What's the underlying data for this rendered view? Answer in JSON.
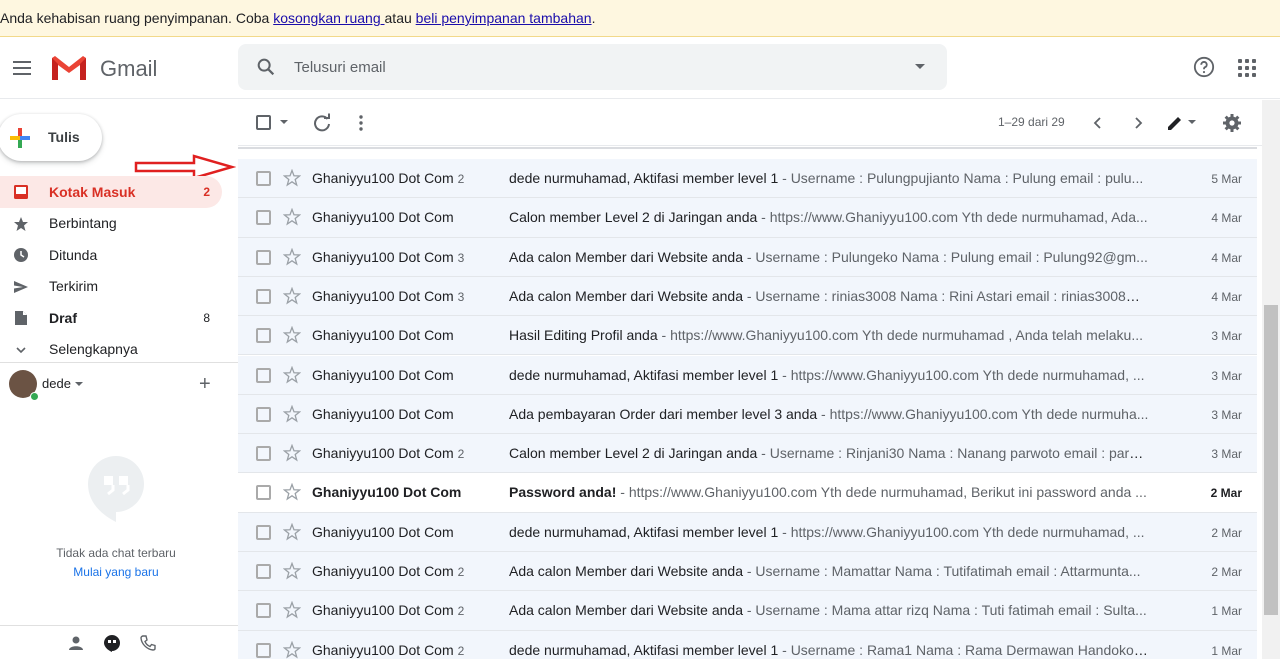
{
  "banner": {
    "text_before": "Anda kehabisan ruang penyimpanan. Coba ",
    "link1": "kosongkan ruang ",
    "text_mid": "atau ",
    "link2": "beli penyimpanan tambahan",
    "text_after": "."
  },
  "header": {
    "app_name": "Gmail",
    "search_placeholder": "Telusuri email"
  },
  "compose": {
    "label": "Tulis"
  },
  "sidebar": {
    "items": [
      {
        "label": "Kotak Masuk",
        "count": "2",
        "icon": "inbox-icon",
        "active": true
      },
      {
        "label": "Berbintang",
        "count": "",
        "icon": "star-icon"
      },
      {
        "label": "Ditunda",
        "count": "",
        "icon": "clock-icon"
      },
      {
        "label": "Terkirim",
        "count": "",
        "icon": "send-icon"
      },
      {
        "label": "Draf",
        "count": "8",
        "icon": "draft-icon"
      },
      {
        "label": "Selengkapnya",
        "count": "",
        "icon": "chevron-down-icon"
      }
    ]
  },
  "chat": {
    "user": "dede",
    "empty_text": "Tidak ada chat terbaru",
    "start_link": "Mulai yang baru"
  },
  "toolbar": {
    "pagination": "1–29 dari 29"
  },
  "emails": [
    {
      "sender": "Ghaniyyu100 Dot Com",
      "count": "2",
      "subject": "dede nurmuhamad, Aktifasi member level 1",
      "snippet": " - Username : Pulungpujianto Nama : Pulung email : pulu...",
      "date": "5 Mar",
      "unread": false
    },
    {
      "sender": "Ghaniyyu100 Dot Com",
      "count": "",
      "subject": "Calon member Level 2 di Jaringan anda",
      "snippet": " - https://www.Ghaniyyu100.com Yth dede nurmuhamad, Ada...",
      "date": "4 Mar",
      "unread": false
    },
    {
      "sender": "Ghaniyyu100 Dot Com",
      "count": "3",
      "subject": "Ada calon Member dari Website anda",
      "snippet": " - Username : Pulungeko Nama : Pulung email : Pulung92@gm...",
      "date": "4 Mar",
      "unread": false
    },
    {
      "sender": "Ghaniyyu100 Dot Com",
      "count": "3",
      "subject": "Ada calon Member dari Website anda",
      "snippet": " - Username : rinias3008 Nama : Rini Astari email : rinias3008@...",
      "date": "4 Mar",
      "unread": false
    },
    {
      "sender": "Ghaniyyu100 Dot Com",
      "count": "",
      "subject": "Hasil Editing Profil anda",
      "snippet": " - https://www.Ghaniyyu100.com Yth dede nurmuhamad , Anda telah melaku...",
      "date": "3 Mar",
      "unread": false
    },
    {
      "sender": "Ghaniyyu100 Dot Com",
      "count": "",
      "subject": "dede nurmuhamad, Aktifasi member level 1",
      "snippet": " - https://www.Ghaniyyu100.com Yth dede nurmuhamad, ...",
      "date": "3 Mar",
      "unread": false
    },
    {
      "sender": "Ghaniyyu100 Dot Com",
      "count": "",
      "subject": "Ada pembayaran Order dari member level 3 anda",
      "snippet": " - https://www.Ghaniyyu100.com Yth dede nurmuha...",
      "date": "3 Mar",
      "unread": false
    },
    {
      "sender": "Ghaniyyu100 Dot Com",
      "count": "2",
      "subject": "Calon member Level 2 di Jaringan anda",
      "snippet": " - Username : Rinjani30 Nama : Nanang parwoto email : parw...",
      "date": "3 Mar",
      "unread": false
    },
    {
      "sender": "Ghaniyyu100 Dot Com",
      "count": "",
      "subject": "Password anda!",
      "snippet": " - https://www.Ghaniyyu100.com Yth dede nurmuhamad, Berikut ini password anda ...",
      "date": "2 Mar",
      "unread": true
    },
    {
      "sender": "Ghaniyyu100 Dot Com",
      "count": "",
      "subject": "dede nurmuhamad, Aktifasi member level 1",
      "snippet": " - https://www.Ghaniyyu100.com Yth dede nurmuhamad, ...",
      "date": "2 Mar",
      "unread": false
    },
    {
      "sender": "Ghaniyyu100 Dot Com",
      "count": "2",
      "subject": "Ada calon Member dari Website anda",
      "snippet": " - Username : Mamattar Nama : Tutifatimah email : Attarmunta...",
      "date": "2 Mar",
      "unread": false
    },
    {
      "sender": "Ghaniyyu100 Dot Com",
      "count": "2",
      "subject": "Ada calon Member dari Website anda",
      "snippet": " - Username : Mama attar rizq Nama : Tuti fatimah email : Sulta...",
      "date": "1 Mar",
      "unread": false
    },
    {
      "sender": "Ghaniyyu100 Dot Com",
      "count": "2",
      "subject": "dede nurmuhamad, Aktifasi member level 1",
      "snippet": " - Username : Rama1 Nama : Rama Dermawan Handoko ...",
      "date": "1 Mar",
      "unread": false
    }
  ],
  "colors": {
    "accent_red": "#d93025",
    "banner_bg": "#fef7e0",
    "read_row_bg": "#f2f6fc",
    "link_blue": "#1a0dab"
  }
}
